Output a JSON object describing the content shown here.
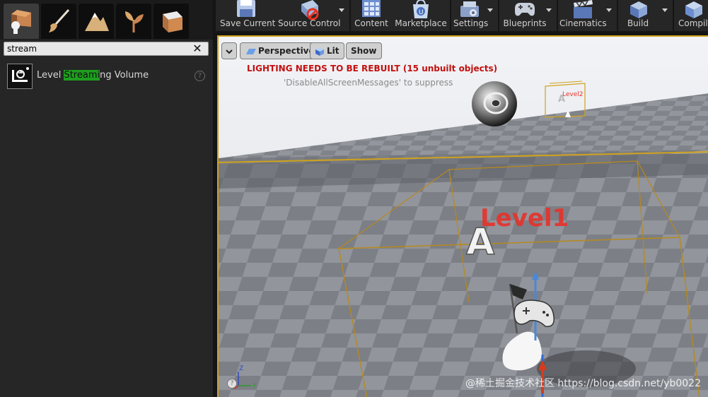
{
  "modes_panel": {
    "tabs": [
      {
        "name": "place-mode",
        "active": true
      },
      {
        "name": "paint-mode",
        "active": false
      },
      {
        "name": "landscape-mode",
        "active": false
      },
      {
        "name": "foliage-mode",
        "active": false
      },
      {
        "name": "geometry-mode",
        "active": false
      }
    ],
    "search": {
      "value": "stream"
    },
    "results": [
      {
        "label_pre": "Level ",
        "label_highlight": "Streami",
        "label_post": "ng Volume",
        "icon": "volume-icon"
      }
    ],
    "help_glyph": "?"
  },
  "toolbar": {
    "buttons": [
      {
        "label": "Save Current",
        "icon": "save-icon"
      },
      {
        "label": "Source Control",
        "icon": "source-control-icon"
      },
      {
        "label": "Content",
        "icon": "content-browser-icon"
      },
      {
        "label": "Marketplace",
        "icon": "marketplace-icon"
      },
      {
        "label": "Settings",
        "icon": "settings-icon"
      },
      {
        "label": "Blueprints",
        "icon": "blueprints-icon"
      },
      {
        "label": "Cinematics",
        "icon": "cinematics-icon"
      },
      {
        "label": "Build",
        "icon": "build-icon"
      },
      {
        "label": "Compile",
        "icon": "compile-icon"
      }
    ]
  },
  "viewport": {
    "view_mode": "Perspective",
    "lighting_mode": "Lit",
    "show_label": "Show",
    "warning": "LIGHTING NEEDS TO BE REBUILT (15 unbuilt objects)",
    "suppress_hint": "'DisableAllScreenMessages' to suppress",
    "level_labels": {
      "near": "Level1",
      "far": "Level2"
    },
    "axis_labels": {
      "z": "Z",
      "y": "Y"
    },
    "watermark": "@稀土掘金技术社区 https://blog.csdn.net/yb0022",
    "colors": {
      "selection": "#cfa21c",
      "warning": "#c21010",
      "level_label": "#e8312a"
    }
  }
}
